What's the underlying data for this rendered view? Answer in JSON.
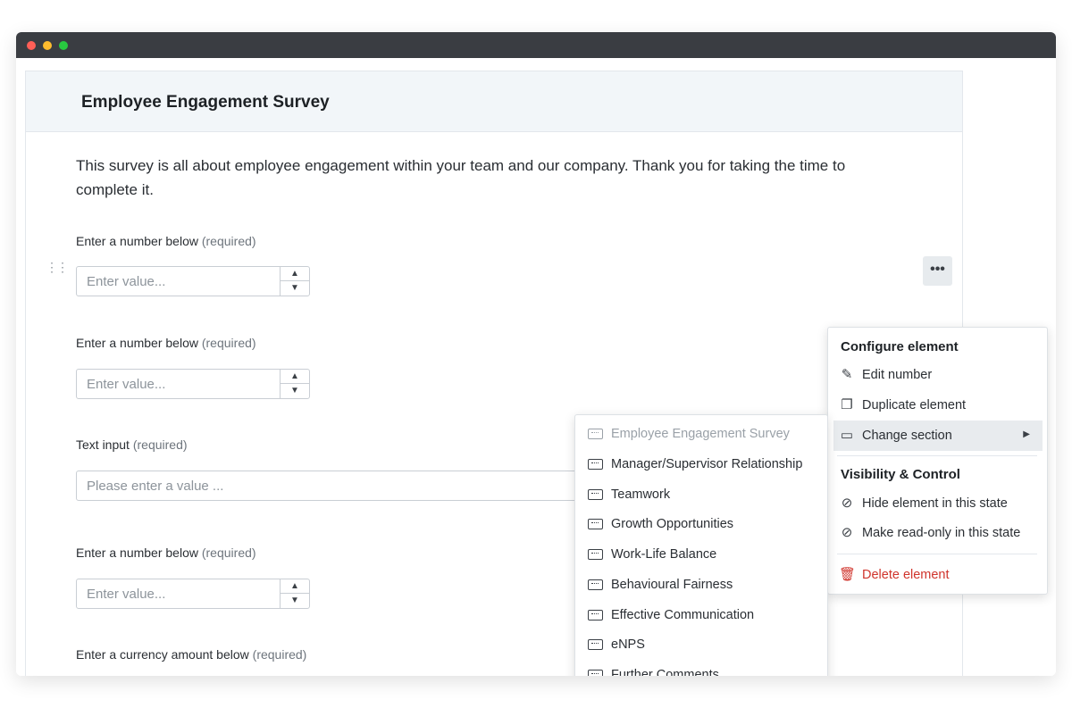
{
  "survey": {
    "title": "Employee Engagement Survey",
    "intro": "This survey is all about employee engagement within your team and our company. Thank you for taking the time to complete it."
  },
  "fields": [
    {
      "label": "Enter a number below",
      "required": "(required)",
      "placeholder": "Enter value..."
    },
    {
      "label": "Enter a number below",
      "required": "(required)",
      "placeholder": "Enter value..."
    },
    {
      "label": "Text input",
      "required": "(required)",
      "placeholder": "Please enter a value ..."
    },
    {
      "label": "Enter a number below",
      "required": "(required)",
      "placeholder": "Enter value..."
    },
    {
      "label": "Enter a currency amount below",
      "required": "(required)"
    }
  ],
  "icons": {
    "drag": "⋮⋮",
    "more": "•••",
    "spin_up": "▲",
    "spin_down": "▼",
    "edit": "✎",
    "duplicate": "❐",
    "section": "▭",
    "hide": "⊘",
    "readonly": "⊘",
    "delete": "🗑",
    "submenu_arrow": "▶"
  },
  "config_menu": {
    "heading1": "Configure element",
    "edit": "Edit number",
    "duplicate": "Duplicate element",
    "change_section": "Change section",
    "heading2": "Visibility & Control",
    "hide": "Hide element in this state",
    "readonly": "Make read-only in this state",
    "delete": "Delete element"
  },
  "section_menu": [
    "Employee Engagement Survey",
    "Manager/Supervisor Relationship",
    "Teamwork",
    "Growth Opportunities",
    "Work-Life Balance",
    "Behavioural Fairness",
    "Effective Communication",
    "eNPS",
    "Further Comments"
  ],
  "colors": {
    "danger": "#d0342c",
    "header_bg": "#f2f6f9",
    "titlebar": "#3a3d42"
  }
}
